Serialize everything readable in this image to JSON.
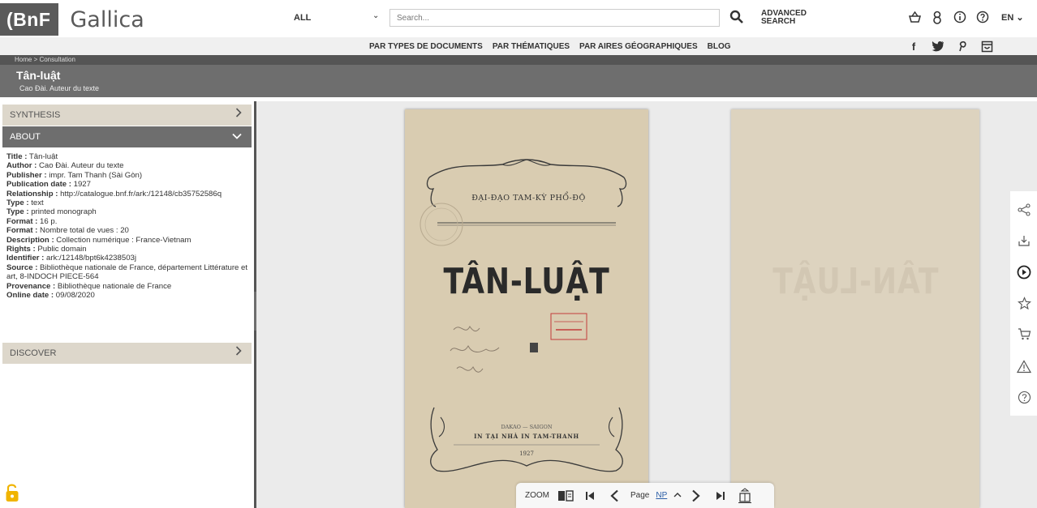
{
  "header": {
    "logo_bnf": "(BnF",
    "logo_gallica": "Gallica",
    "scope": "ALL",
    "search_placeholder": "Search...",
    "advanced_search": "ADVANCED SEARCH",
    "lang": "EN"
  },
  "nav": {
    "links": [
      "PAR TYPES DE DOCUMENTS",
      "PAR THÉMATIQUES",
      "PAR AIRES GÉOGRAPHIQUES",
      "BLOG"
    ]
  },
  "breadcrumb": "Home > Consultation",
  "document": {
    "title": "Tân-luật",
    "author": "Cao Đài. Auteur du texte"
  },
  "sidebar": {
    "synthesis": "SYNTHESIS",
    "about": "ABOUT",
    "discover": "DISCOVER",
    "about_rows": [
      {
        "label": "Title :",
        "value": " Tân-luật"
      },
      {
        "label": "Author :",
        "value": " Cao Đài. Auteur du texte"
      },
      {
        "label": "Publisher :",
        "value": " impr. Tam Thanh (Sài Gòn)"
      },
      {
        "label": "Publication date :",
        "value": " 1927"
      },
      {
        "label": "Relationship :",
        "value": " http://catalogue.bnf.fr/ark:/12148/cb35752586q"
      },
      {
        "label": "Type :",
        "value": " text"
      },
      {
        "label": "Type :",
        "value": " printed monograph"
      },
      {
        "label": "Format :",
        "value": " 16 p."
      },
      {
        "label": "Format :",
        "value": " Nombre total de vues : 20"
      },
      {
        "label": "Description :",
        "value": " Collection numérique : France-Vietnam"
      },
      {
        "label": "Rights :",
        "value": " Public domain"
      },
      {
        "label": "Identifier :",
        "value": " ark:/12148/bpt6k4238503j"
      },
      {
        "label": "Source :",
        "value": " Bibliothèque nationale de France, département Littérature et art, 8-INDOCH PIECE-564"
      },
      {
        "label": "Provenance :",
        "value": " Bibliothèque nationale de France"
      },
      {
        "label": "Online date :",
        "value": " 09/08/2020"
      }
    ]
  },
  "viewer": {
    "page_heading": "ĐẠI-ĐẠO TAM-KỲ PHỔ-ĐỘ",
    "page_title": "TÂN-LUẬT",
    "page_city": "DAKAO — SAIGON",
    "page_printer": "IN TẠI NHÀ IN TAM-THANH",
    "page_year": "1927",
    "ghost_title": "TÂN-LUẬT"
  },
  "toolbar": {
    "zoom": "ZOOM",
    "page_label": "Page",
    "page_value": "NP"
  },
  "colors": {
    "band": "#6e6e6e",
    "accordion": "#ddd7cb",
    "link": "#2b5ea7"
  }
}
